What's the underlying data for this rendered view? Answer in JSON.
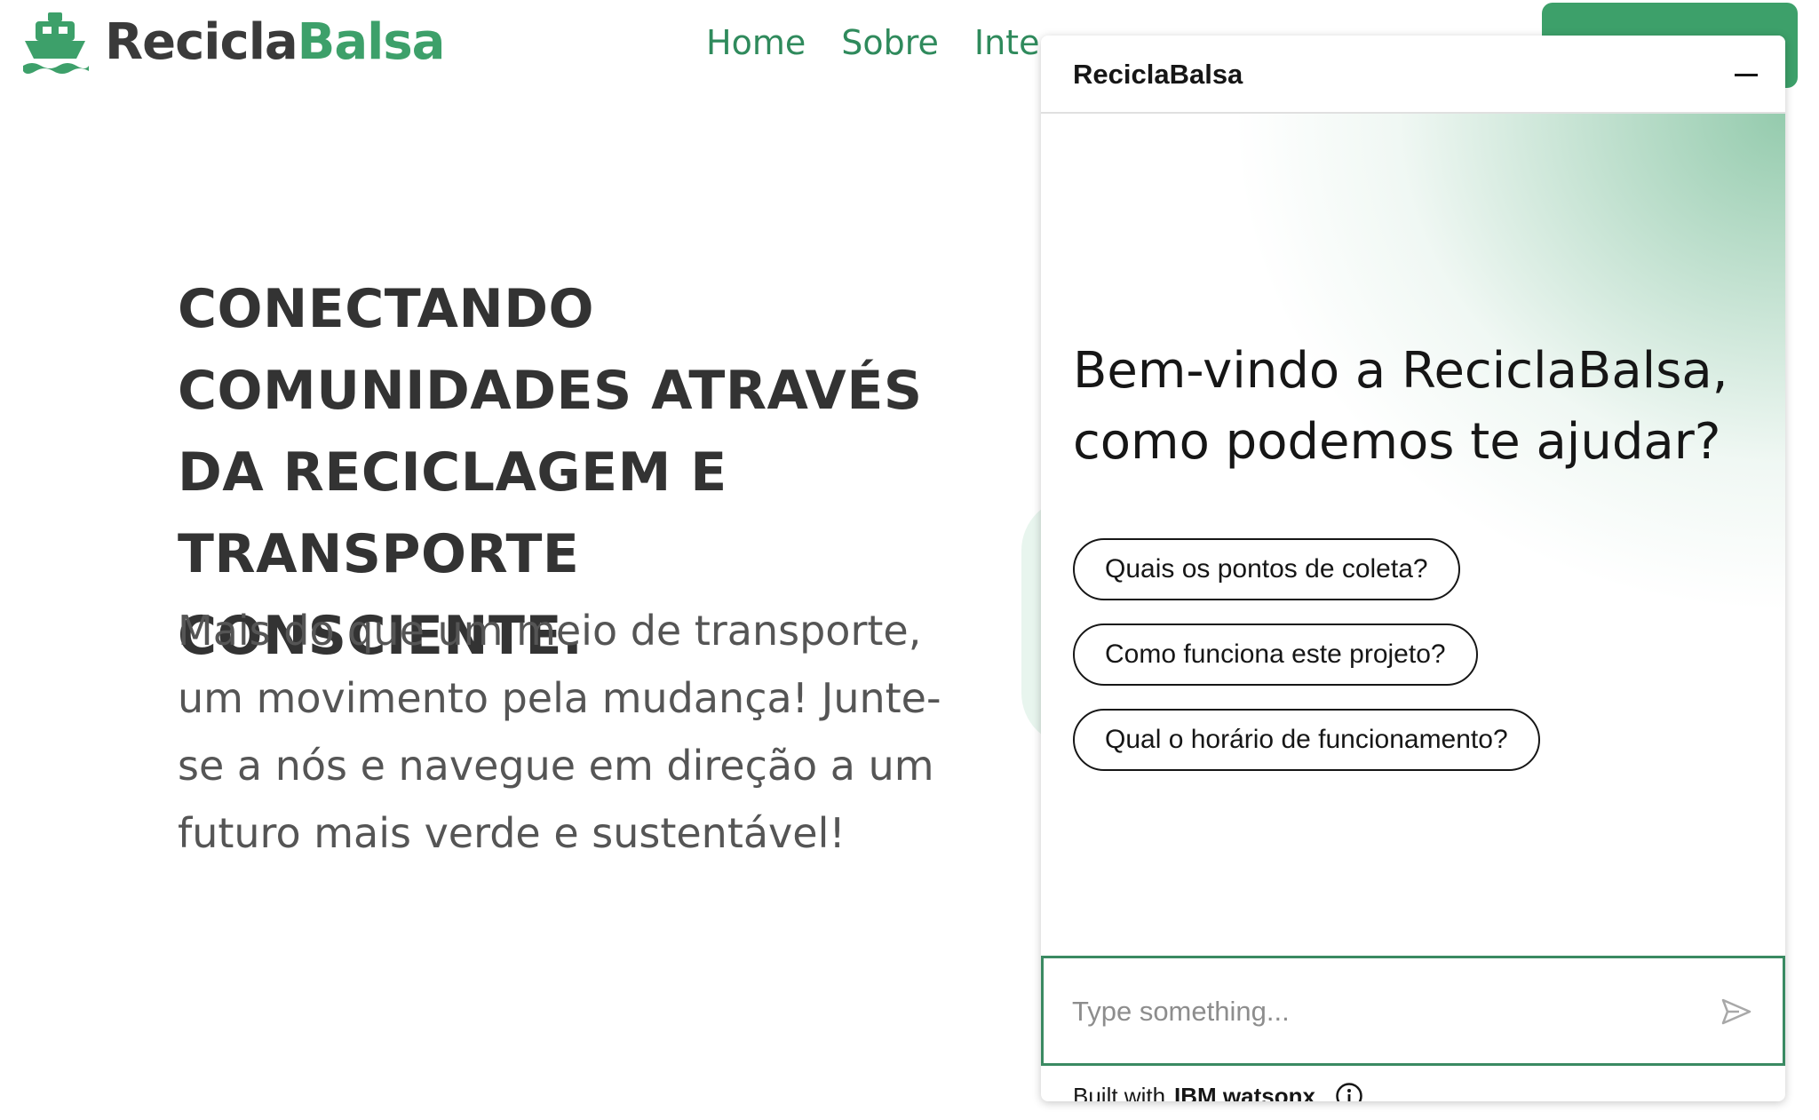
{
  "brand": {
    "name_part1": "Recicla",
    "name_part2": "Balsa",
    "icon": "ship-icon"
  },
  "nav": {
    "items": [
      "Home",
      "Sobre",
      "Inte"
    ],
    "cta_label": ""
  },
  "hero": {
    "title": "CONECTANDO COMUNIDADES ATRAVÉS DA RECICLAGEM E TRANSPORTE CONSCIENTE.",
    "subtitle": "Mais do que um meio de transporte, um movimento pela mudança! Junte-se a nós e navegue em direção a um futuro mais verde e sustentável!"
  },
  "chat": {
    "header_title": "ReciclaBalsa",
    "welcome": "Bem-vindo a ReciclaBalsa, como podemos te ajudar?",
    "suggestions": [
      "Quais os pontos de coleta?",
      "Como funciona este projeto?",
      "Qual o horário de funcionamento?"
    ],
    "input_placeholder": "Type something...",
    "footer_prefix": "Built with",
    "footer_brand": "IBM watsonx"
  },
  "colors": {
    "brand_green": "#3da06a",
    "nav_green": "#2f8a5c",
    "text_dark": "#333333"
  }
}
